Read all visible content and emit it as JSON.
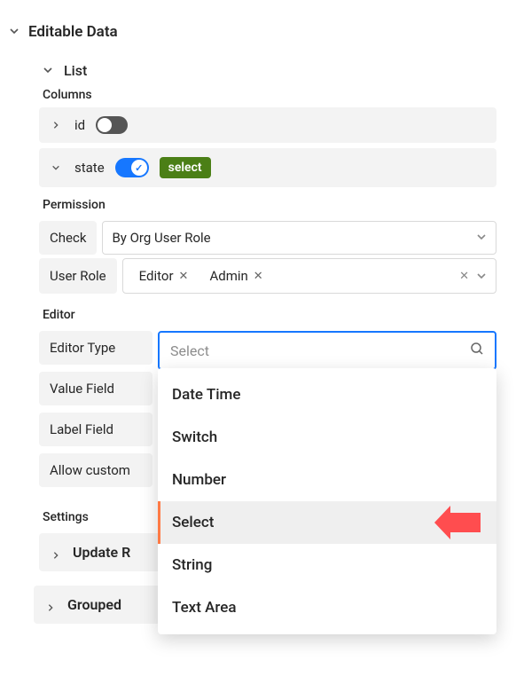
{
  "section": {
    "title": "Editable Data"
  },
  "list": {
    "title": "List",
    "columns_label": "Columns",
    "rows": [
      {
        "name": "id",
        "enabled": false
      },
      {
        "name": "state",
        "enabled": true,
        "badge": "select"
      }
    ]
  },
  "permission": {
    "label": "Permission",
    "check_label": "Check",
    "check_value": "By Org User Role",
    "role_label": "User Role",
    "roles": [
      "Editor",
      "Admin"
    ]
  },
  "editor": {
    "label": "Editor",
    "type_label": "Editor Type",
    "search_placeholder": "Select",
    "value_field_label": "Value Field",
    "label_field_label": "Label Field",
    "allow_custom_label": "Allow custom",
    "options": [
      "Date Time",
      "Switch",
      "Number",
      "Select",
      "String",
      "Text Area"
    ],
    "highlighted": "Select"
  },
  "settings": {
    "label": "Settings",
    "update_row": "Update R"
  },
  "grouped": {
    "title": "Grouped"
  }
}
